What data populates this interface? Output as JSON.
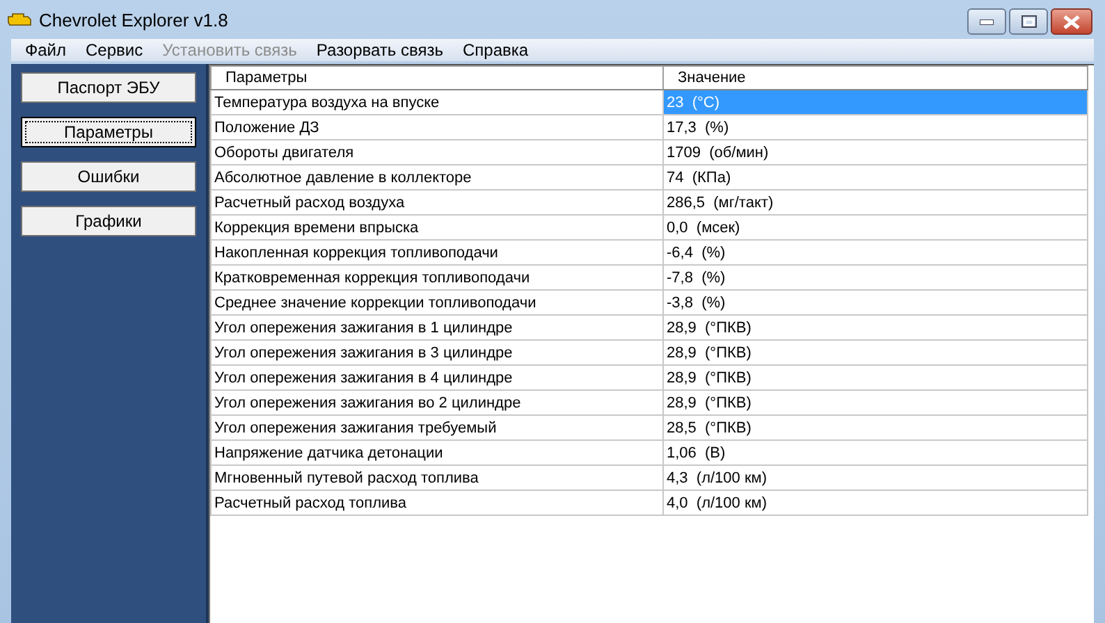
{
  "window": {
    "title": "Chevrolet Explorer v1.8"
  },
  "menu": [
    {
      "label": "Файл",
      "disabled": false
    },
    {
      "label": "Сервис",
      "disabled": false
    },
    {
      "label": "Установить связь",
      "disabled": true
    },
    {
      "label": "Разорвать связь",
      "disabled": false
    },
    {
      "label": "Справка",
      "disabled": false
    }
  ],
  "sidebar": {
    "buttons": [
      {
        "label": "Паспорт ЭБУ",
        "selected": false
      },
      {
        "label": "Параметры",
        "selected": true
      },
      {
        "label": "Ошибки",
        "selected": false
      },
      {
        "label": "Графики",
        "selected": false
      }
    ]
  },
  "table": {
    "columns": [
      "Параметры",
      "Значение"
    ],
    "rows": [
      {
        "name": "Температура воздуха на впуске",
        "value": "23  (°C)",
        "selected": true
      },
      {
        "name": "Положение ДЗ",
        "value": "17,3  (%)",
        "selected": false
      },
      {
        "name": "Обороты двигателя",
        "value": "1709  (об/мин)",
        "selected": false
      },
      {
        "name": "Абсолютное давление в коллекторе",
        "value": "74  (КПа)",
        "selected": false
      },
      {
        "name": "Расчетный расход воздуха",
        "value": "286,5  (мг/такт)",
        "selected": false
      },
      {
        "name": "Коррекция времени впрыска",
        "value": "0,0  (мсек)",
        "selected": false
      },
      {
        "name": "Накопленная коррекция топливоподачи",
        "value": "-6,4  (%)",
        "selected": false
      },
      {
        "name": "Кратковременная коррекция топливоподачи",
        "value": "-7,8  (%)",
        "selected": false
      },
      {
        "name": "Среднее значение коррекции топливоподачи",
        "value": "-3,8  (%)",
        "selected": false
      },
      {
        "name": "Угол опережения зажигания в 1 цилиндре",
        "value": "28,9  (°ПКВ)",
        "selected": false
      },
      {
        "name": "Угол опережения зажигания в 3 цилиндре",
        "value": "28,9  (°ПКВ)",
        "selected": false
      },
      {
        "name": "Угол опережения зажигания в 4 цилиндре",
        "value": "28,9  (°ПКВ)",
        "selected": false
      },
      {
        "name": "Угол опережения зажигания во 2 цилиндре",
        "value": "28,9  (°ПКВ)",
        "selected": false
      },
      {
        "name": "Угол опережения зажигания требуемый",
        "value": "28,5  (°ПКВ)",
        "selected": false
      },
      {
        "name": "Напряжение датчика детонации",
        "value": "1,06  (В)",
        "selected": false
      },
      {
        "name": "Мгновенный путевой расход топлива",
        "value": "4,3  (л/100 км)",
        "selected": false
      },
      {
        "name": "Расчетный расход топлива",
        "value": "4,0  (л/100 км)",
        "selected": false
      }
    ]
  }
}
